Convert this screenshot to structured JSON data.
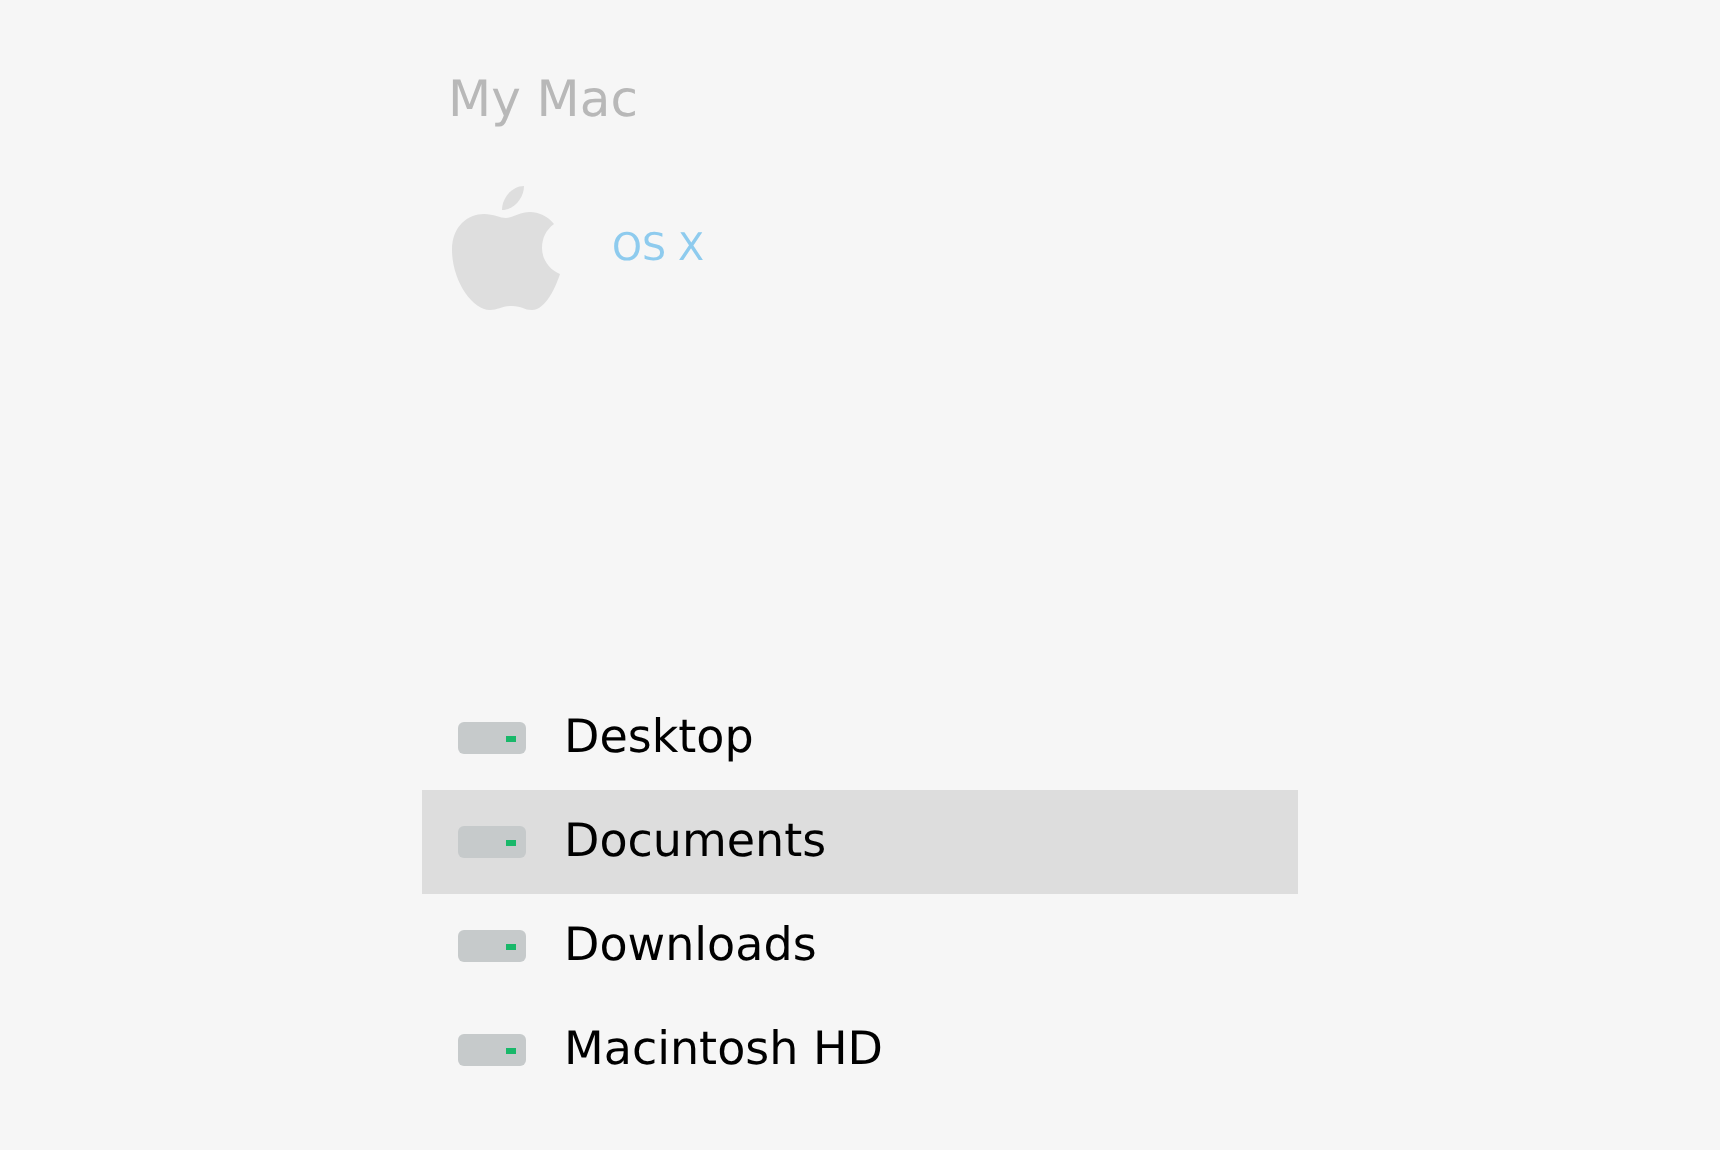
{
  "title": "My Mac",
  "system": {
    "label": "OS X"
  },
  "locations": [
    {
      "label": "Desktop",
      "selected": false
    },
    {
      "label": "Documents",
      "selected": true
    },
    {
      "label": "Downloads",
      "selected": false
    },
    {
      "label": "Macintosh HD",
      "selected": false
    }
  ]
}
